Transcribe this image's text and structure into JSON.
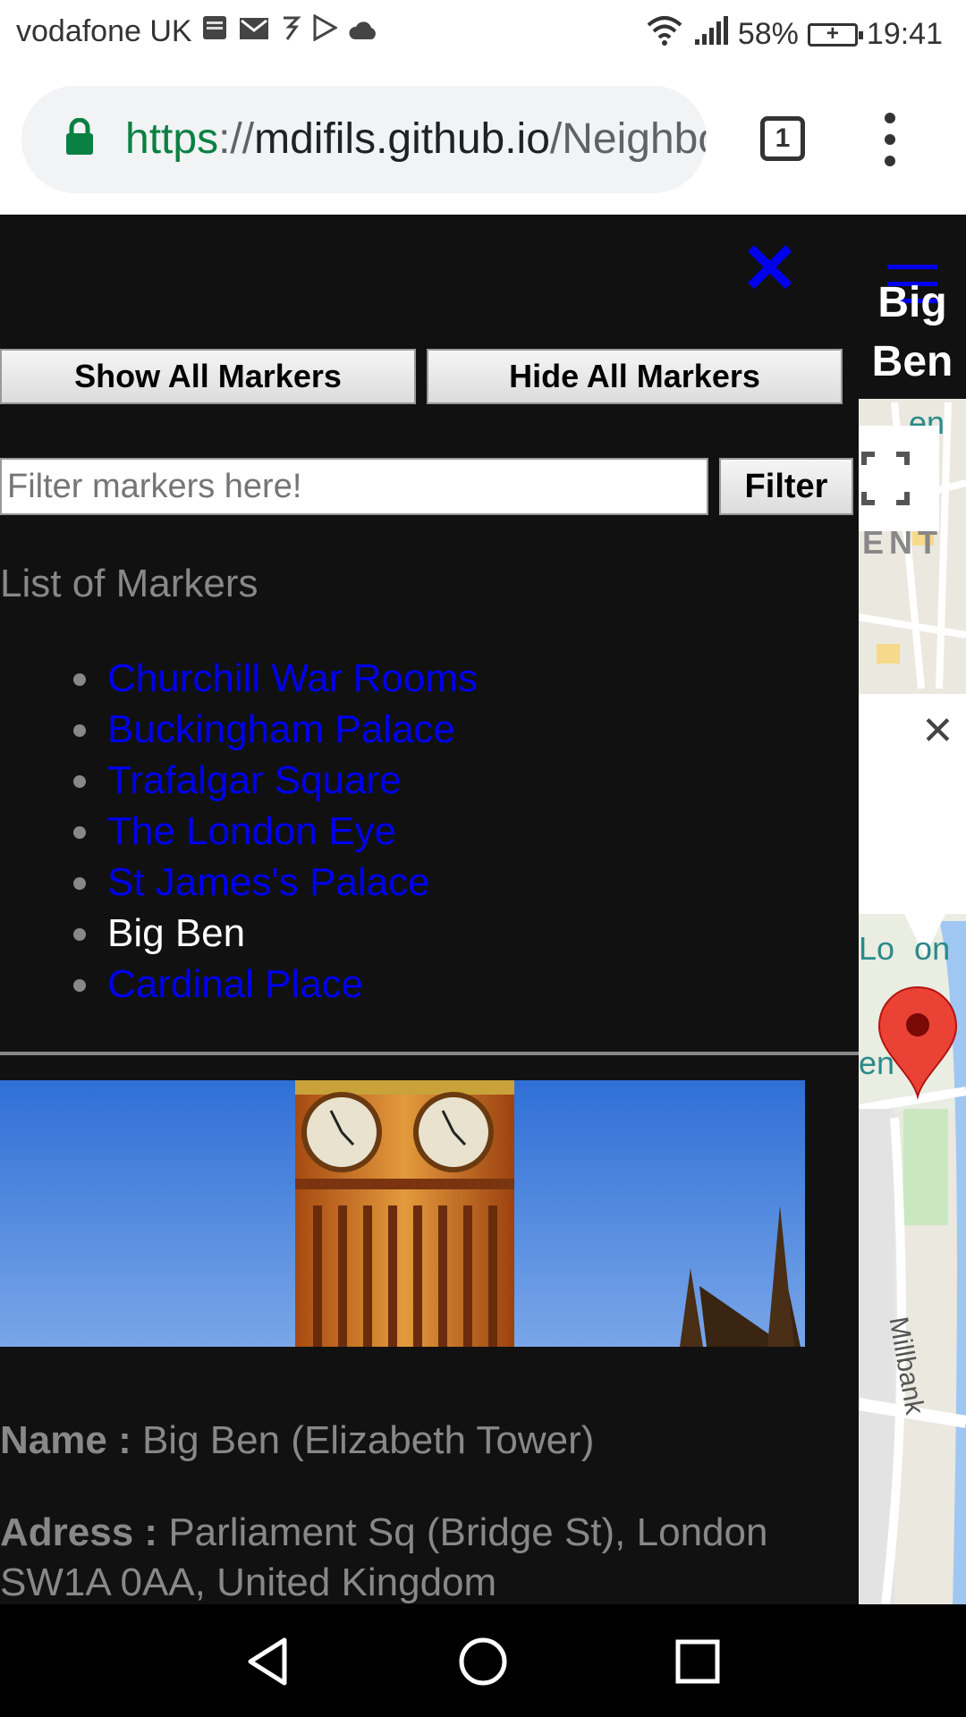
{
  "status_bar": {
    "carrier": "vodafone UK",
    "battery": "58%",
    "time": "19:41",
    "icons": [
      "bible-app-icon",
      "gmail-icon",
      "flash-icon",
      "play-store-icon",
      "cloud-icon",
      "wifi-icon",
      "signal-icon",
      "battery-charging-icon"
    ]
  },
  "browser": {
    "url_scheme": "https",
    "url_sep": "://",
    "url_host": "mdifils.github.io",
    "url_path": "/Neighborhood-Map",
    "tab_count": "1"
  },
  "sidebar": {
    "show_all_label": "Show All Markers",
    "hide_all_label": "Hide All Markers",
    "filter_placeholder": "Filter markers here!",
    "filter_label": "Filter",
    "list_title": "List of Markers",
    "markers": [
      "Churchill War Rooms",
      "Buckingham Palace",
      "Trafalgar Square",
      "The London Eye",
      "St James's Palace",
      "Big Ben",
      "Cardinal Place"
    ],
    "selected_marker": "Big Ben"
  },
  "info": {
    "name_label": "Name :",
    "name_value": "Big Ben (Elizabeth Tower)",
    "adress_label": "Adress :",
    "adress_value": "Parliament Sq (Bridge St), London SW1A 0AA, United Kingdom"
  },
  "map": {
    "title": "Big Ben",
    "labels": [
      "ENT",
      "Lo",
      "on",
      "en"
    ],
    "street": "Millbank"
  },
  "colors": {
    "link": "#0000ee",
    "background": "#111111",
    "url_green": "#0b8043",
    "pin_red": "#ea4335"
  }
}
